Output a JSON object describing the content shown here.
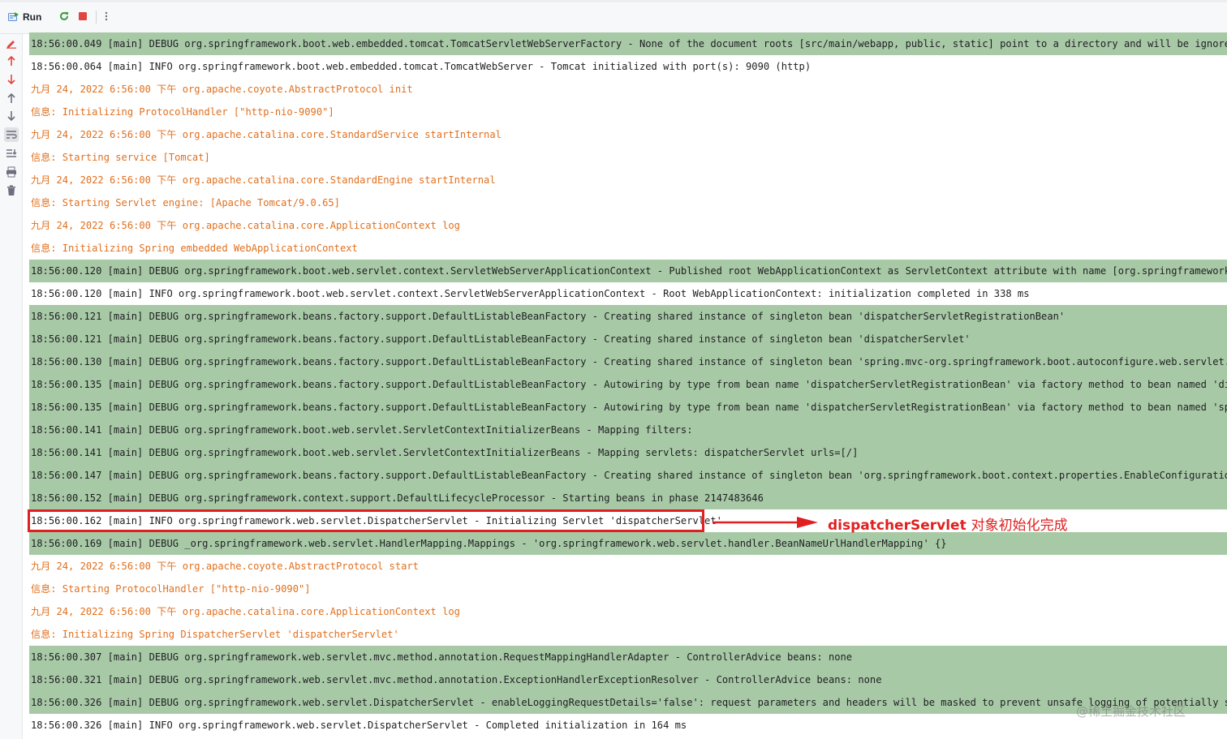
{
  "toolbar": {
    "run_label": "Run",
    "icons": [
      "run-icon",
      "rerun-icon",
      "stop-icon",
      "more-icon"
    ]
  },
  "sidebar": {
    "icons": [
      "edit-config-icon",
      "up-arrow-red-icon",
      "down-arrow-red-icon",
      "up-arrow-icon",
      "down-arrow-icon",
      "soft-wrap-icon",
      "scroll-to-end-icon",
      "print-icon",
      "trash-icon"
    ]
  },
  "console": {
    "lines": [
      {
        "type": "debug",
        "text": "18:56:00.049 [main] DEBUG org.springframework.boot.web.embedded.tomcat.TomcatServletWebServerFactory - None of the document roots [src/main/webapp, public, static] point to a directory and will be ignored."
      },
      {
        "type": "info",
        "text": "18:56:00.064 [main] INFO org.springframework.boot.web.embedded.tomcat.TomcatWebServer - Tomcat initialized with port(s): 9090 (http)"
      },
      {
        "type": "err",
        "text": "九月 24, 2022 6:56:00 下午 org.apache.coyote.AbstractProtocol init"
      },
      {
        "type": "err",
        "text": "信息: Initializing ProtocolHandler [\"http-nio-9090\"]"
      },
      {
        "type": "err",
        "text": "九月 24, 2022 6:56:00 下午 org.apache.catalina.core.StandardService startInternal"
      },
      {
        "type": "err",
        "text": "信息: Starting service [Tomcat]"
      },
      {
        "type": "err",
        "text": "九月 24, 2022 6:56:00 下午 org.apache.catalina.core.StandardEngine startInternal"
      },
      {
        "type": "err",
        "text": "信息: Starting Servlet engine: [Apache Tomcat/9.0.65]"
      },
      {
        "type": "err",
        "text": "九月 24, 2022 6:56:00 下午 org.apache.catalina.core.ApplicationContext log"
      },
      {
        "type": "err",
        "text": "信息: Initializing Spring embedded WebApplicationContext"
      },
      {
        "type": "debug",
        "text": "18:56:00.120 [main] DEBUG org.springframework.boot.web.servlet.context.ServletWebServerApplicationContext - Published root WebApplicationContext as ServletContext attribute with name [org.springframework.web.co"
      },
      {
        "type": "info",
        "text": "18:56:00.120 [main] INFO org.springframework.boot.web.servlet.context.ServletWebServerApplicationContext - Root WebApplicationContext: initialization completed in 338 ms"
      },
      {
        "type": "debug",
        "text": "18:56:00.121 [main] DEBUG org.springframework.beans.factory.support.DefaultListableBeanFactory - Creating shared instance of singleton bean 'dispatcherServletRegistrationBean'"
      },
      {
        "type": "debug",
        "text": "18:56:00.121 [main] DEBUG org.springframework.beans.factory.support.DefaultListableBeanFactory - Creating shared instance of singleton bean 'dispatcherServlet'"
      },
      {
        "type": "debug",
        "text": "18:56:00.130 [main] DEBUG org.springframework.beans.factory.support.DefaultListableBeanFactory - Creating shared instance of singleton bean 'spring.mvc-org.springframework.boot.autoconfigure.web.servlet.WebMvcP"
      },
      {
        "type": "debug",
        "text": "18:56:00.135 [main] DEBUG org.springframework.beans.factory.support.DefaultListableBeanFactory - Autowiring by type from bean name 'dispatcherServletRegistrationBean' via factory method to bean named 'dispatche"
      },
      {
        "type": "debug",
        "text": "18:56:00.135 [main] DEBUG org.springframework.beans.factory.support.DefaultListableBeanFactory - Autowiring by type from bean name 'dispatcherServletRegistrationBean' via factory method to bean named 'spring.mv"
      },
      {
        "type": "debug",
        "text": "18:56:00.141 [main] DEBUG org.springframework.boot.web.servlet.ServletContextInitializerBeans - Mapping filters: "
      },
      {
        "type": "debug",
        "text": "18:56:00.141 [main] DEBUG org.springframework.boot.web.servlet.ServletContextInitializerBeans - Mapping servlets: dispatcherServlet urls=[/]"
      },
      {
        "type": "debug",
        "text": "18:56:00.147 [main] DEBUG org.springframework.beans.factory.support.DefaultListableBeanFactory - Creating shared instance of singleton bean 'org.springframework.boot.context.properties.EnableConfigurationProper"
      },
      {
        "type": "debug",
        "text": "18:56:00.152 [main] DEBUG org.springframework.context.support.DefaultLifecycleProcessor - Starting beans in phase 2147483646"
      },
      {
        "type": "info",
        "text": "18:56:00.162 [main] INFO org.springframework.web.servlet.DispatcherServlet - Initializing Servlet 'dispatcherServlet'"
      },
      {
        "type": "debug",
        "text": "18:56:00.169 [main] DEBUG _org.springframework.web.servlet.HandlerMapping.Mappings - 'org.springframework.web.servlet.handler.BeanNameUrlHandlerMapping' {}"
      },
      {
        "type": "err",
        "text": "九月 24, 2022 6:56:00 下午 org.apache.coyote.AbstractProtocol start"
      },
      {
        "type": "err",
        "text": "信息: Starting ProtocolHandler [\"http-nio-9090\"]"
      },
      {
        "type": "err",
        "text": "九月 24, 2022 6:56:00 下午 org.apache.catalina.core.ApplicationContext log"
      },
      {
        "type": "err",
        "text": "信息: Initializing Spring DispatcherServlet 'dispatcherServlet'"
      },
      {
        "type": "debug",
        "text": "18:56:00.307 [main] DEBUG org.springframework.web.servlet.mvc.method.annotation.RequestMappingHandlerAdapter - ControllerAdvice beans: none"
      },
      {
        "type": "debug",
        "text": "18:56:00.321 [main] DEBUG org.springframework.web.servlet.mvc.method.annotation.ExceptionHandlerExceptionResolver - ControllerAdvice beans: none"
      },
      {
        "type": "debug",
        "text": "18:56:00.326 [main] DEBUG org.springframework.web.servlet.DispatcherServlet - enableLoggingRequestDetails='false': request parameters and headers will be masked to prevent unsafe logging of potentially sensitiv"
      },
      {
        "type": "info",
        "text": "18:56:00.326 [main] INFO org.springframework.web.servlet.DispatcherServlet - Completed initialization in 164 ms"
      }
    ]
  },
  "annotation": {
    "label_en": "dispatcherServlet ",
    "label_cn": "对象初始化完成",
    "color": "#e02020"
  },
  "watermark": "@稀土掘金技术社区",
  "colors": {
    "debug_bg": "#a8c9a6",
    "err_text": "#e0701f"
  }
}
